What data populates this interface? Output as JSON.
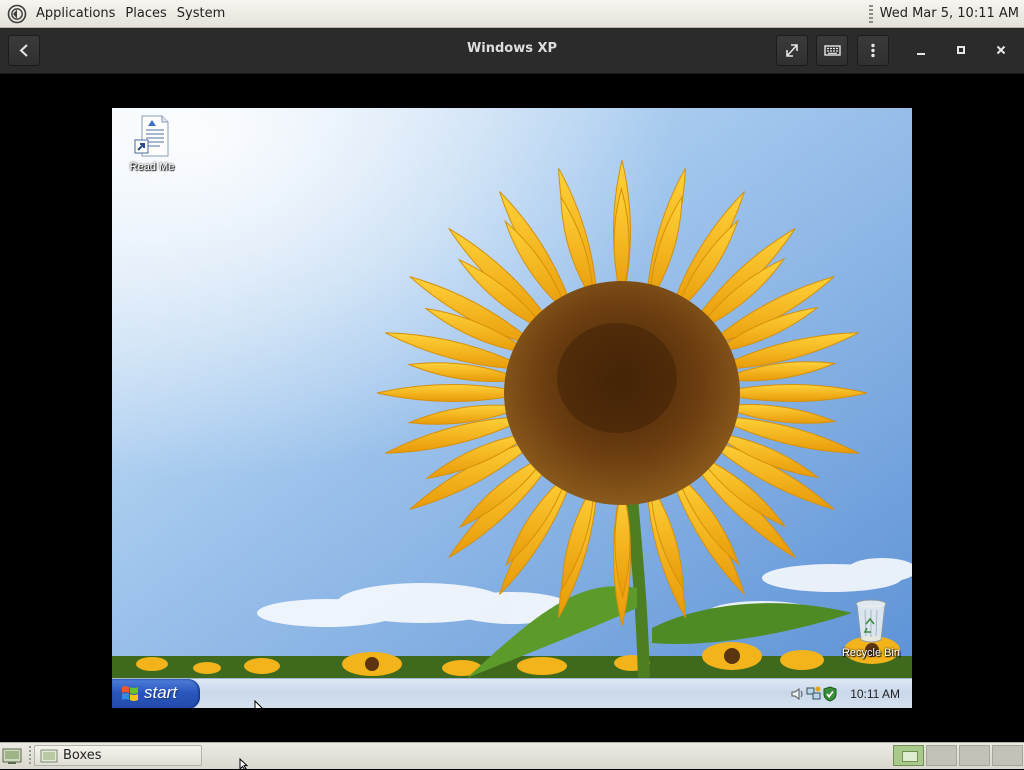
{
  "top_panel": {
    "menus": [
      "Applications",
      "Places",
      "System"
    ],
    "clock": "Wed Mar  5, 10:11 AM",
    "icons": {
      "logo": "gnome-foot-icon"
    }
  },
  "boxes_window": {
    "title": "Windows XP",
    "icons": {
      "back": "back-arrow-icon",
      "fullscreen": "fullscreen-icon",
      "keyboard": "keyboard-icon",
      "menu": "vertical-dots-icon",
      "minimize": "minimize-icon",
      "maximize": "maximize-icon",
      "close": "close-icon"
    }
  },
  "guest_desktop": {
    "desktop_icons": [
      {
        "label": "Read Me",
        "icon": "document-shortcut-icon"
      },
      {
        "label": "Recycle Bin",
        "icon": "recycle-bin-icon"
      }
    ],
    "wallpaper": "sunflower",
    "taskbar": {
      "start_label": "start",
      "clock": "10:11 AM",
      "tray_icons": [
        "volume-icon",
        "network-icon",
        "security-shield-icon"
      ]
    }
  },
  "bottom_panel": {
    "tasks": [
      {
        "label": "Boxes",
        "icon": "boxes-app-icon"
      }
    ],
    "show_desktop_icon": "show-desktop-icon",
    "workspaces": 4,
    "active_workspace": 1
  },
  "colors": {
    "header_bg": "#2b2b2b",
    "panel_bg": "#e4e2da",
    "xp_start": "#2a57bd",
    "sky": "#7eaee0",
    "petal": "#f6b814",
    "seed": "#6b3d10"
  }
}
